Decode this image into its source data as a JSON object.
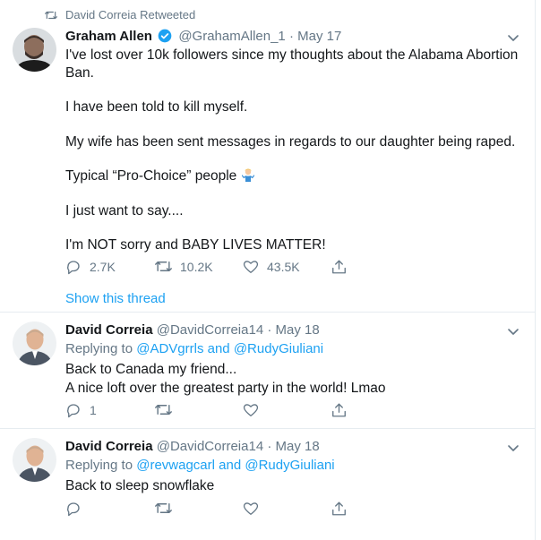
{
  "retweet_banner": {
    "text": "David Correia Retweeted",
    "icon": "retweet-icon"
  },
  "tweets": [
    {
      "name": "Graham Allen",
      "handle": "@GrahamAllen_1",
      "date": "· May 17",
      "verified": true,
      "paragraphs": [
        "I've lost over 10k followers since my thoughts about the Alabama Abortion Ban.",
        "I have been told to kill myself.",
        "My wife has been sent messages in regards to our daughter being raped.",
        "Typical “Pro-Choice” people",
        "I just want to say....",
        "I'm NOT sorry and BABY LIVES MATTER!"
      ],
      "emoji": "person-shrugging-emoji",
      "replies": "2.7K",
      "retweets": "10.2K",
      "likes": "43.5K",
      "show_thread": "Show this thread"
    },
    {
      "name": "David Correia",
      "handle": "@DavidCorreia14",
      "date": "· May 18",
      "replying_prefix": "Replying to",
      "mention_1": "@ADVgrrls",
      "and_word": "and",
      "mention_2": "@RudyGiuliani",
      "line_1": "Back to Canada my friend...",
      "line_2": "A nice loft over the greatest party in the world! Lmao",
      "replies": "1"
    },
    {
      "name": "David Correia",
      "handle": "@DavidCorreia14",
      "date": "· May 18",
      "replying_prefix": "Replying to",
      "mention_1": "@revwagcarl",
      "and_word": "and",
      "mention_2": "@RudyGiuliani",
      "line_1": "Back to sleep snowflake"
    }
  ],
  "colors": {
    "link": "#1da1f2",
    "muted": "#657786",
    "text": "#14171a",
    "divider": "#e6ecf0"
  }
}
